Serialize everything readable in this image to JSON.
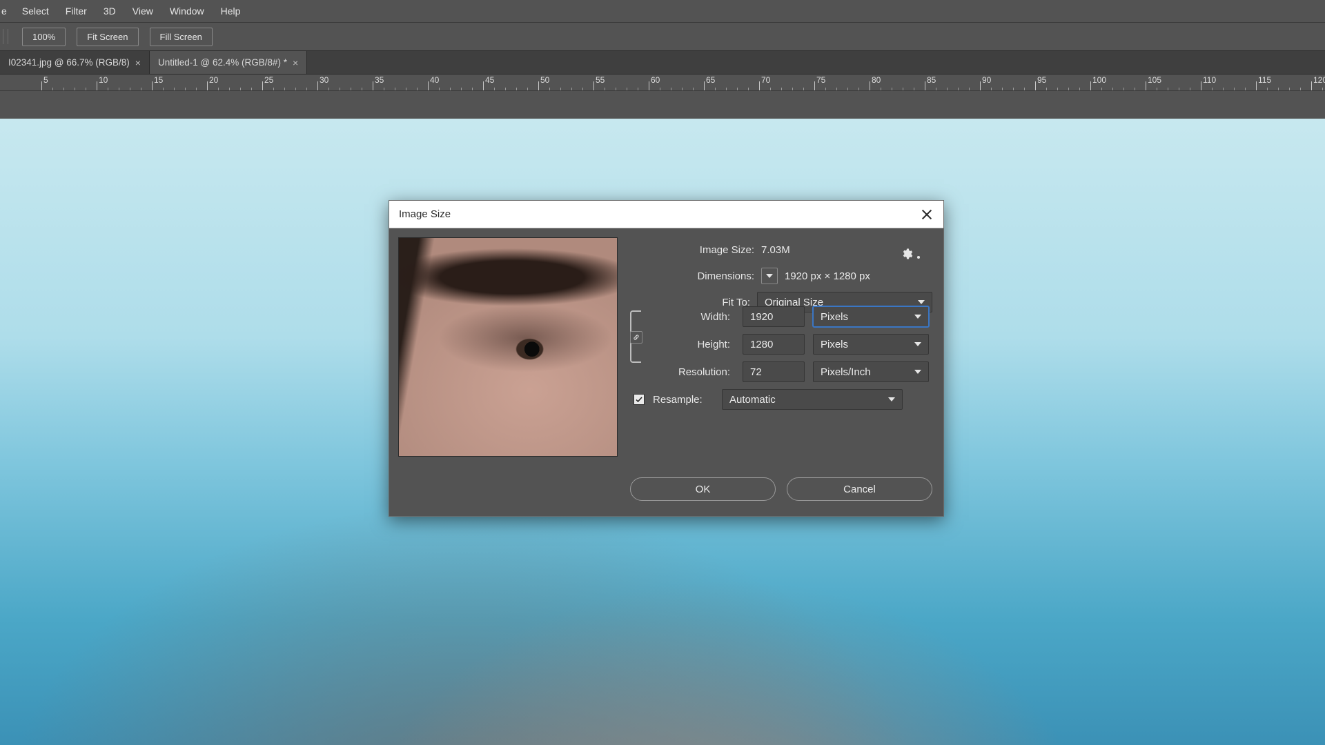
{
  "menu": [
    "e",
    "Select",
    "Filter",
    "3D",
    "View",
    "Window",
    "Help"
  ],
  "options_bar": {
    "zoom": "100%",
    "fit_screen": "Fit Screen",
    "fill_screen": "Fill Screen"
  },
  "tabs": [
    {
      "label": "I02341.jpg @ 66.7% (RGB/8)",
      "active": false
    },
    {
      "label": "Untitled-1 @ 62.4% (RGB/8#) *",
      "active": true
    }
  ],
  "ruler": {
    "start": 5,
    "step": 5,
    "count": 30
  },
  "dialog": {
    "title": "Image Size",
    "image_size_label": "Image Size:",
    "image_size_value": "7.03M",
    "dimensions_label": "Dimensions:",
    "dimensions_value": "1920 px  ×  1280 px",
    "fit_to_label": "Fit To:",
    "fit_to_value": "Original Size",
    "width_label": "Width:",
    "width_value": "1920",
    "width_unit": "Pixels",
    "height_label": "Height:",
    "height_value": "1280",
    "height_unit": "Pixels",
    "resolution_label": "Resolution:",
    "resolution_value": "72",
    "resolution_unit": "Pixels/Inch",
    "resample_label": "Resample:",
    "resample_value": "Automatic",
    "ok": "OK",
    "cancel": "Cancel"
  }
}
